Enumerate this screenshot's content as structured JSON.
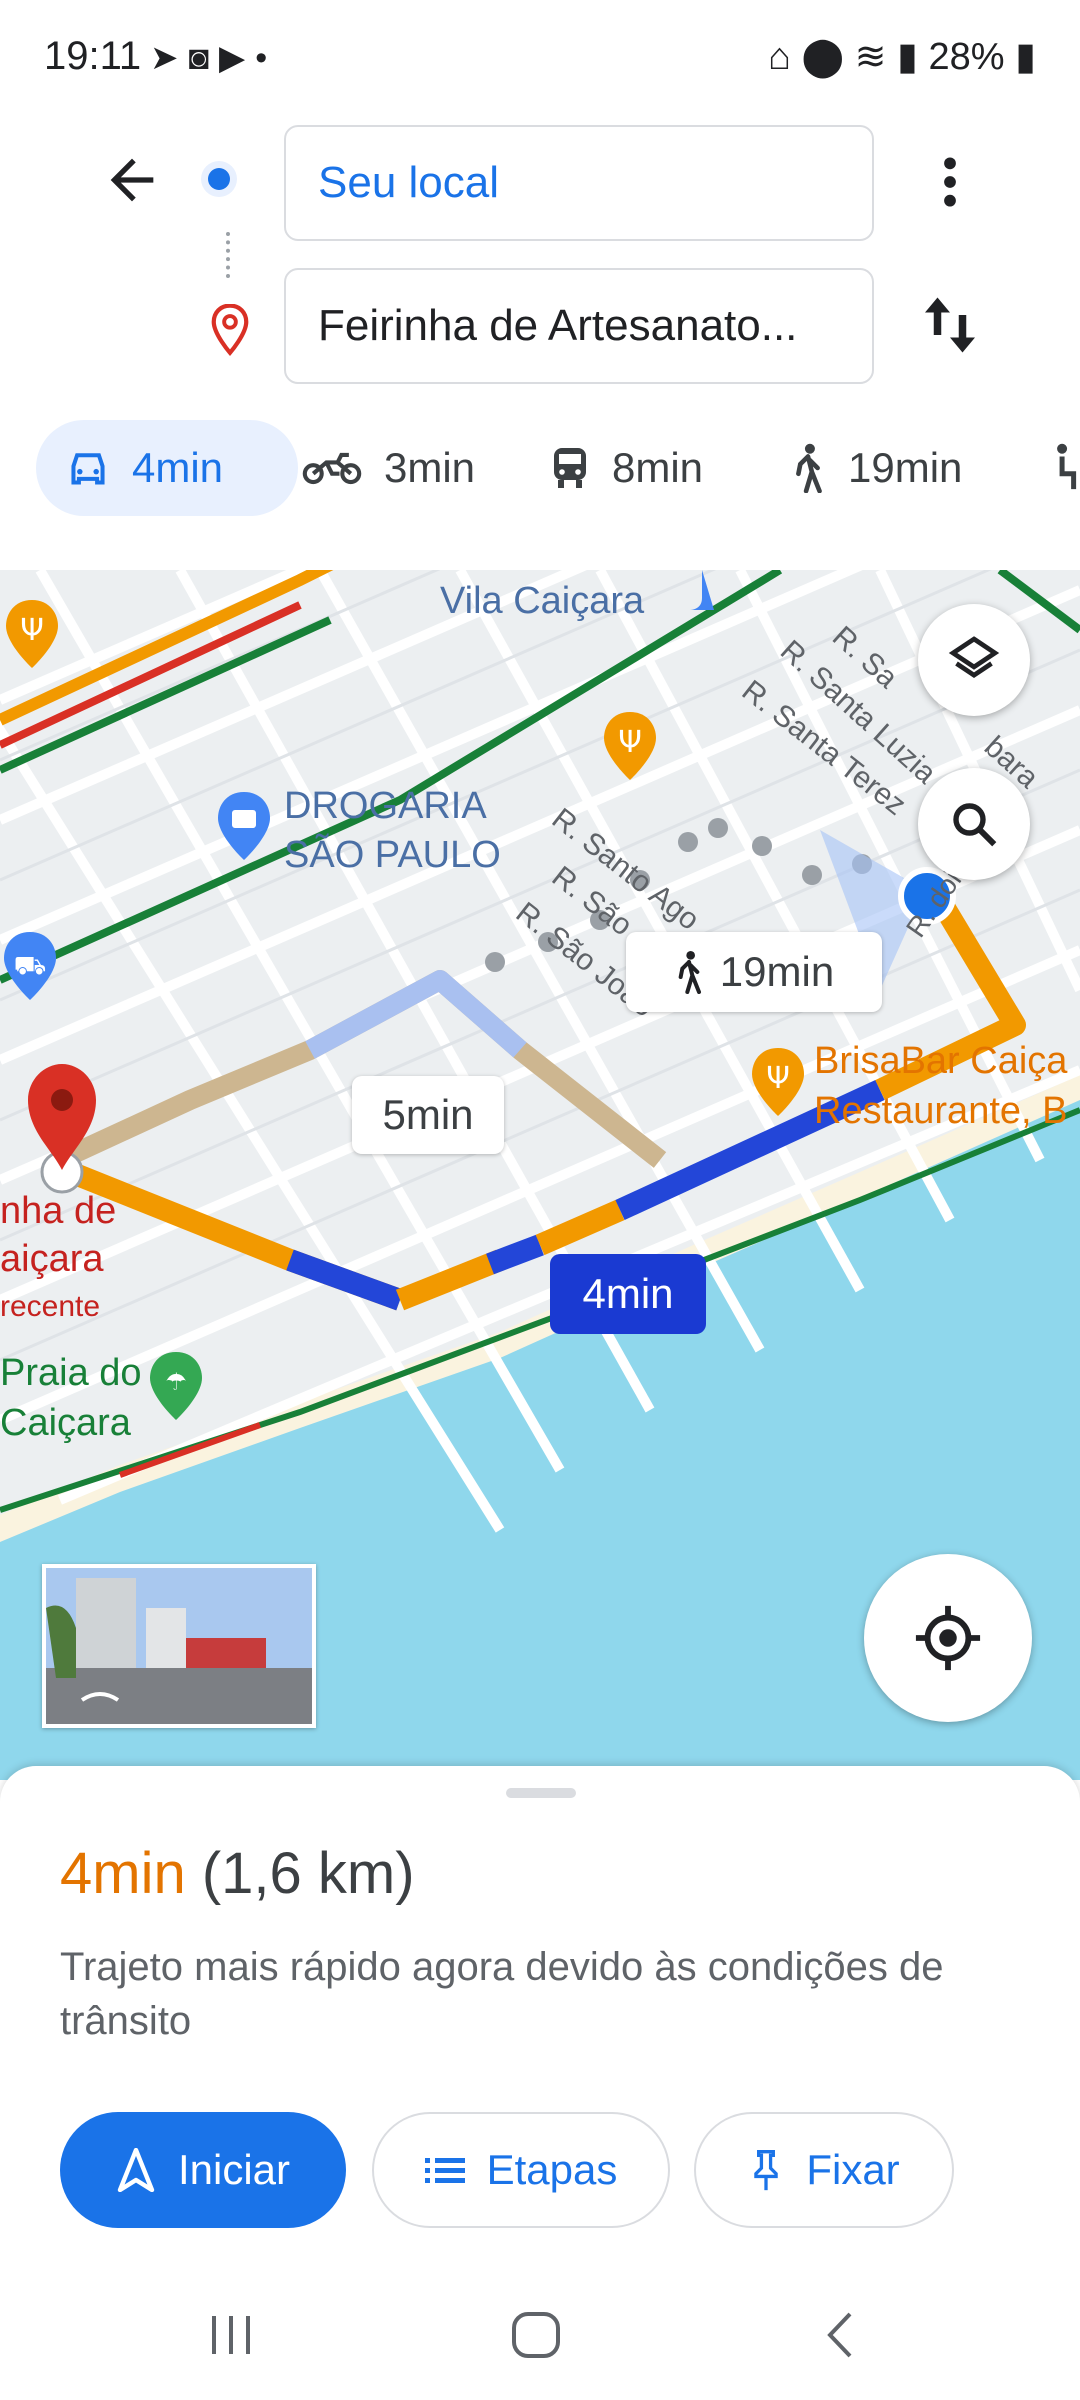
{
  "status_bar": {
    "time": "19:11",
    "left_icons": [
      "send-icon",
      "instagram-icon",
      "youtube-icon",
      "dot"
    ],
    "right_icons": [
      "battery-saver-icon",
      "location-icon",
      "wifi-icon",
      "signal-icon"
    ],
    "battery": "28%"
  },
  "directions": {
    "origin": "Seu local",
    "destination": "Feirinha de Artesanato..."
  },
  "modes": [
    {
      "icon": "car-icon",
      "label": "4min",
      "active": true
    },
    {
      "icon": "motorcycle-icon",
      "label": "3min"
    },
    {
      "icon": "transit-icon",
      "label": "8min"
    },
    {
      "icon": "walk-icon",
      "label": "19min"
    }
  ],
  "map": {
    "labels": {
      "vila": "Vila Caiçara",
      "drogaria_1": "DROGARIA",
      "drogaria_2": "SÃO PAULO",
      "santa_1": "R. Sa",
      "santa_2": "bara",
      "santa_luzia": "R. Santa Luzia",
      "santa_terez": "R. Santa Terez",
      "santo_ago": "R. Santo Ago",
      "sao_1": "R. São",
      "sao_joao": "R. São João",
      "r_dois": "R. dois",
      "brisa_1": "BrisaBar Caiça",
      "brisa_2": "Restaurante, B",
      "feirinha_1": "nha de",
      "feirinha_2": "aiçara",
      "feirinha_3": "recente",
      "praia_1": "Praia do",
      "praia_2": "Caiçara"
    },
    "walk_callout": "19min",
    "alt_callout": "5min",
    "selected_callout": "4min",
    "colors": {
      "water": "#8fd7ec",
      "route_main": "#2346d8",
      "route_traffic": "#f29900",
      "route_alt": "#cdb690"
    }
  },
  "summary": {
    "time": "4min",
    "distance": "(1,6 km)",
    "description": "Trajeto mais rápido agora devido às condições de trânsito"
  },
  "actions": {
    "start": "Iniciar",
    "steps": "Etapas",
    "pin": "Fixar"
  },
  "nav_bar": [
    "recents-icon",
    "home-icon",
    "back-icon"
  ]
}
